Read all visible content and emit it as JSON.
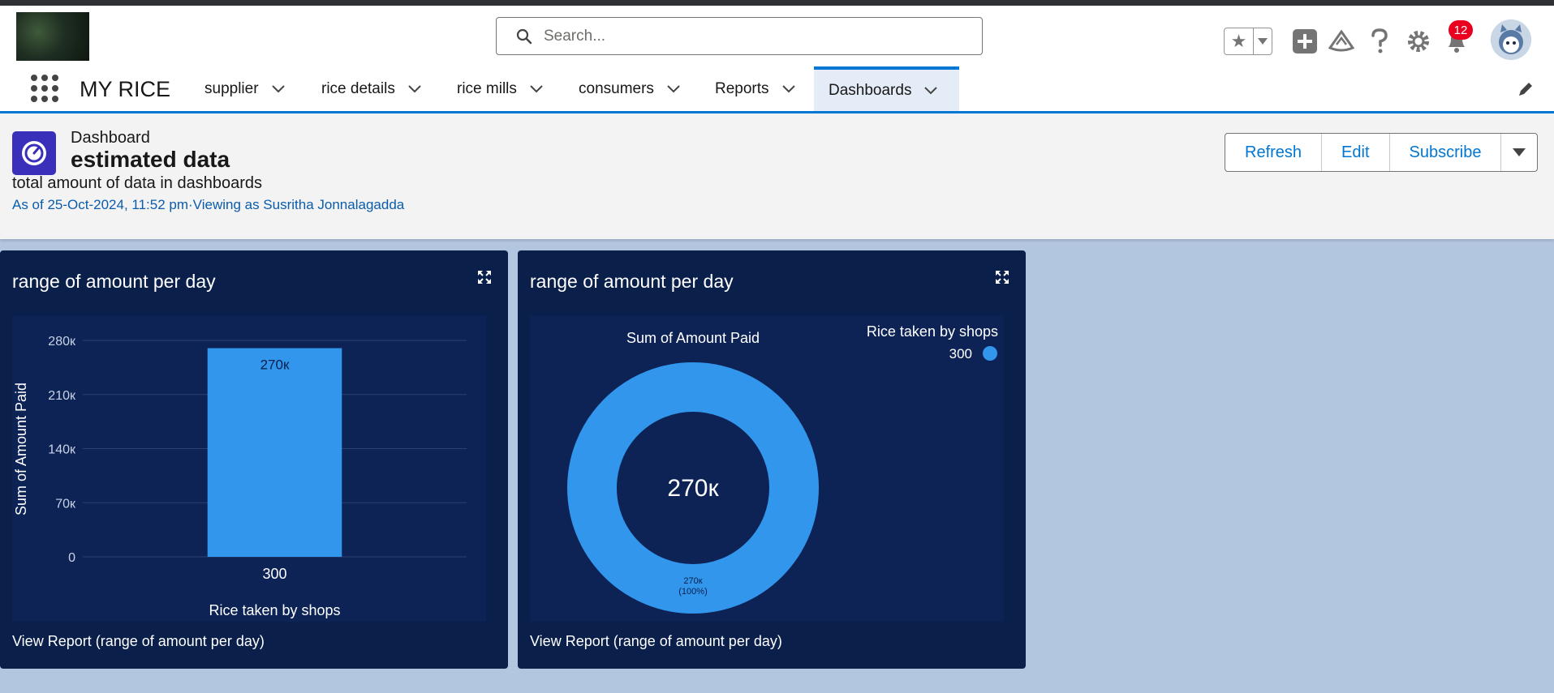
{
  "header": {
    "search_placeholder": "Search...",
    "notification_count": "12",
    "icons": [
      "star-icon",
      "add-icon",
      "trailhead-icon",
      "help-icon",
      "settings-icon",
      "bell-icon"
    ]
  },
  "nav": {
    "app_name": "MY RICE",
    "tabs": [
      {
        "label": "supplier"
      },
      {
        "label": "rice details"
      },
      {
        "label": "rice mills"
      },
      {
        "label": "consumers"
      },
      {
        "label": "Reports"
      },
      {
        "label": "Dashboards",
        "active": true
      }
    ]
  },
  "dashboard": {
    "type_label": "Dashboard",
    "title": "estimated data",
    "description": "total amount of data in dashboards",
    "meta": "As of 25-Oct-2024, 11:52 pm·Viewing as Susritha Jonnalagadda",
    "buttons": {
      "refresh": "Refresh",
      "edit": "Edit",
      "subscribe": "Subscribe"
    }
  },
  "colors": {
    "accent": "#0176d3",
    "card_bg": "#0a1f4a",
    "plot_bg": "#0d2356",
    "bar": "#3296ed",
    "badge": "#ea001e"
  },
  "widgets": [
    {
      "title": "range of amount per day",
      "view_report": "View Report (range of amount per day)"
    },
    {
      "title": "range of amount per day",
      "view_report": "View Report (range of amount per day)"
    }
  ],
  "chart_data": [
    {
      "type": "bar",
      "categories": [
        "300"
      ],
      "values": [
        270000
      ],
      "value_labels": [
        "270к"
      ],
      "xlabel": "Rice taken by shops",
      "ylabel": "Sum of Amount Paid",
      "yticks": [
        "0",
        "70к",
        "140к",
        "210к",
        "280к"
      ],
      "ytick_values": [
        0,
        70000,
        140000,
        210000,
        280000
      ],
      "ylim": [
        0,
        280000
      ],
      "grid": true
    },
    {
      "type": "pie",
      "donut": true,
      "title": "Sum of Amount Paid",
      "legend_title": "Rice taken by shops",
      "legend_position": "top-right",
      "slices": [
        {
          "name": "300",
          "value": 270000,
          "percent": 100
        }
      ],
      "center_label": "270к",
      "slice_label": "270к",
      "slice_percent_label": "(100%)"
    }
  ]
}
